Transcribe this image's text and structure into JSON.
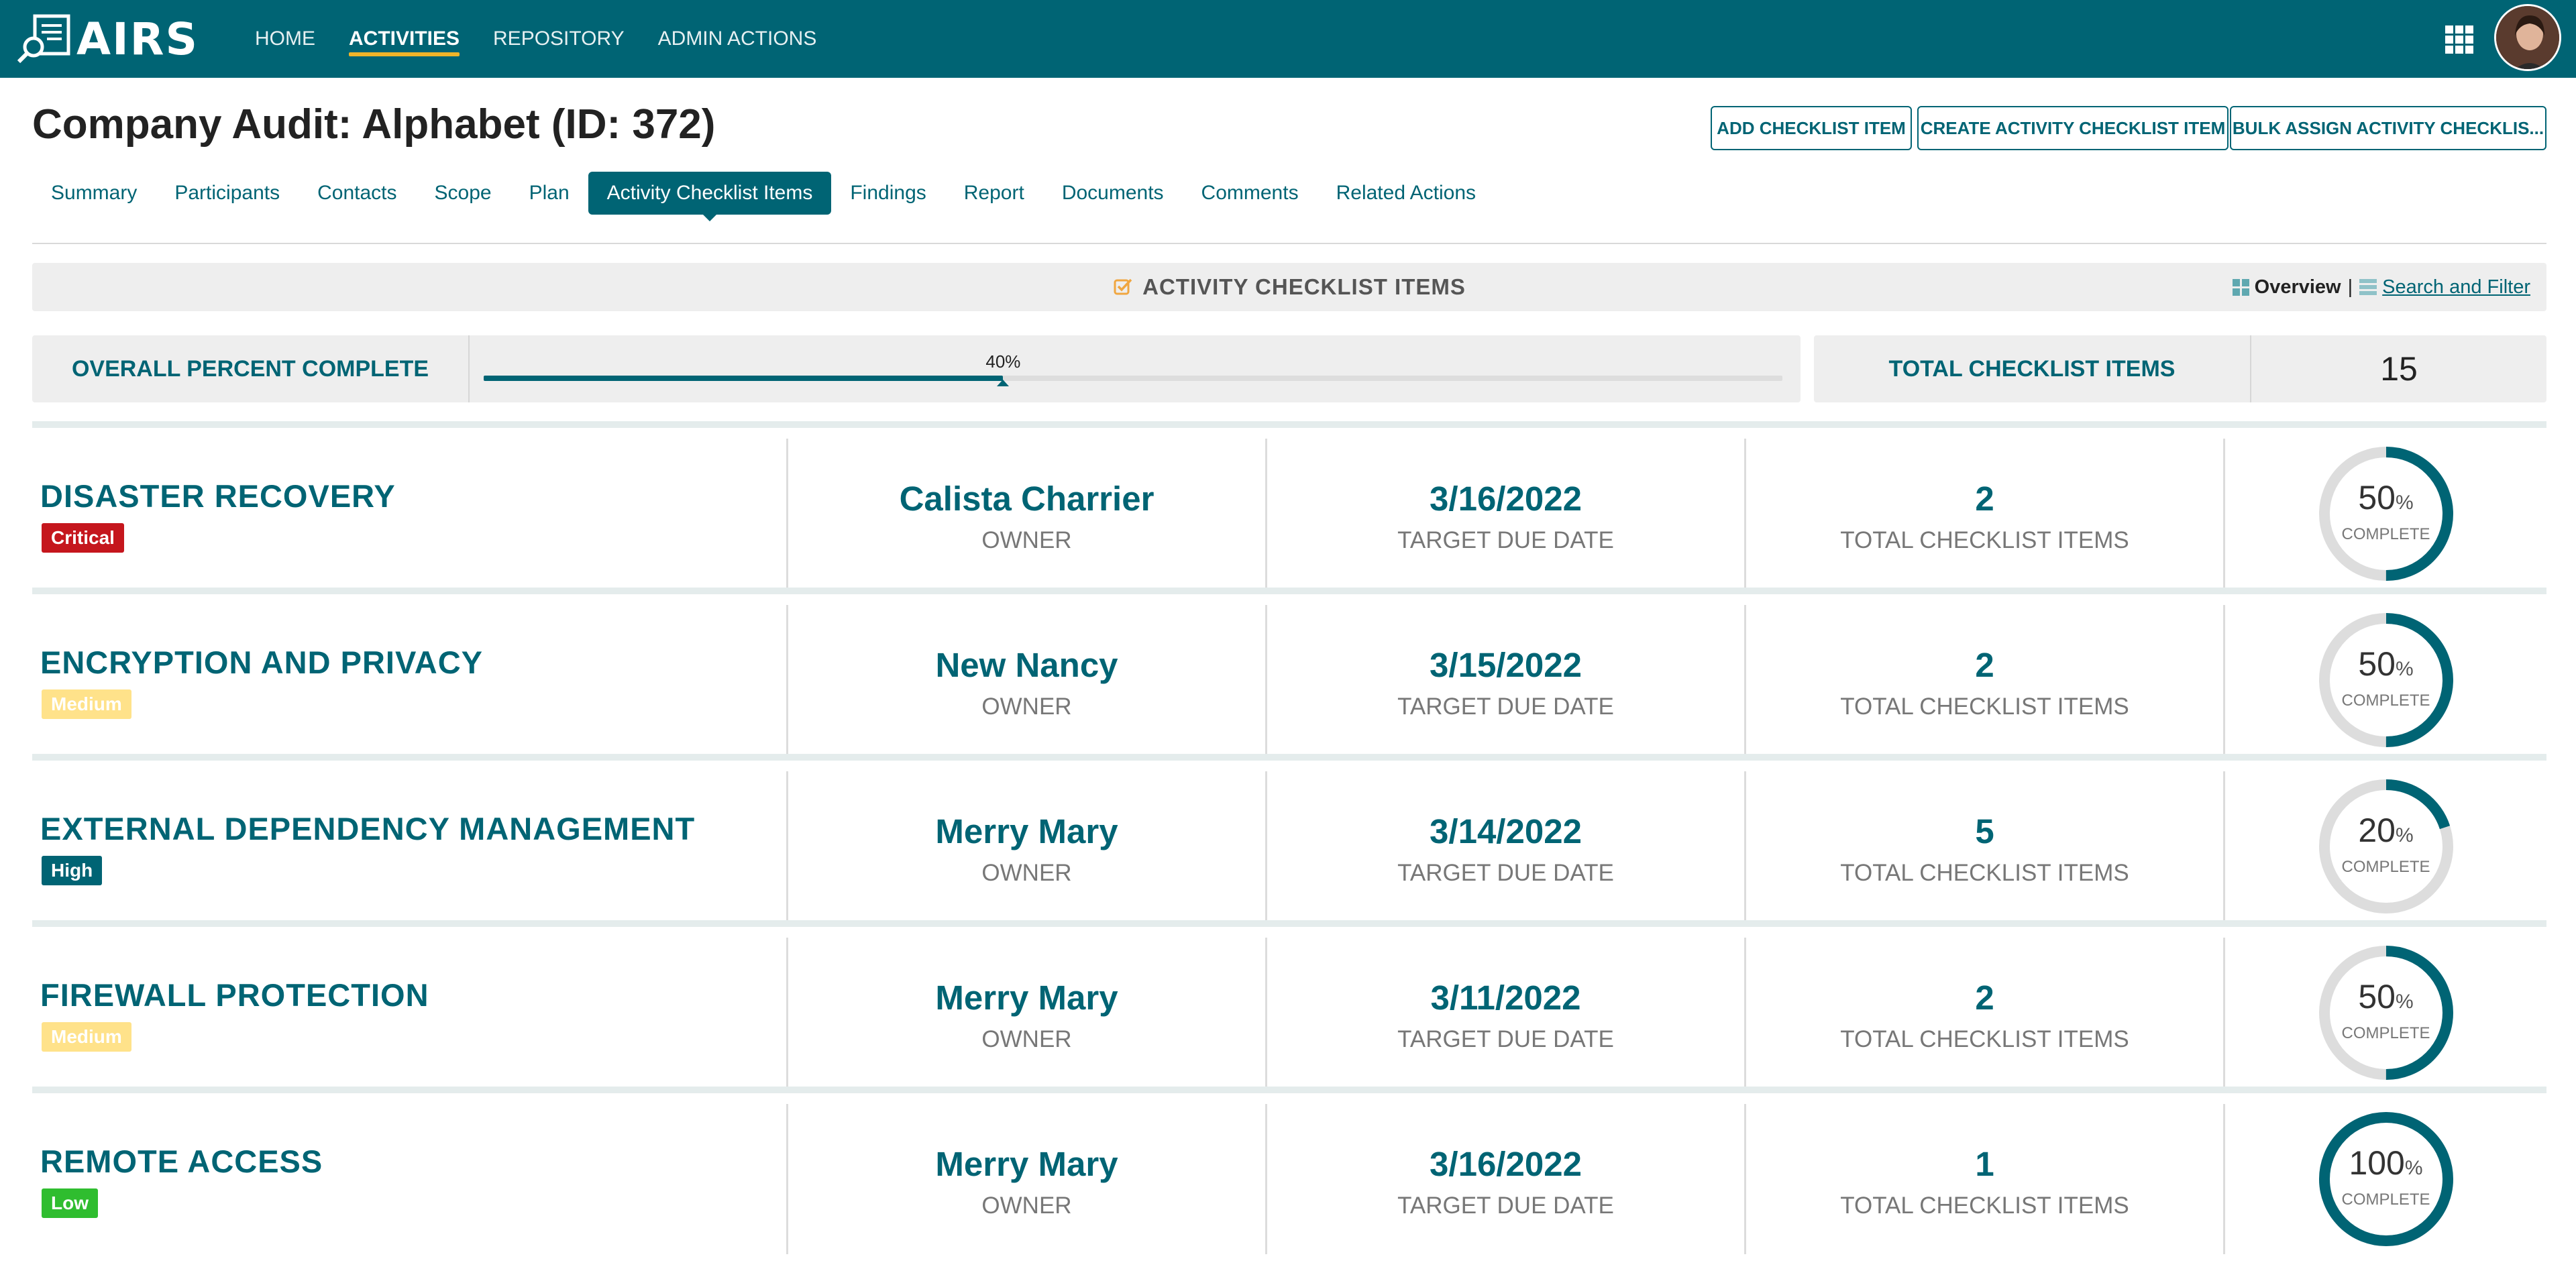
{
  "app": {
    "name": "AIRS"
  },
  "nav": {
    "items": [
      {
        "label": "HOME",
        "active": false
      },
      {
        "label": "ACTIVITIES",
        "active": true
      },
      {
        "label": "REPOSITORY",
        "active": false
      },
      {
        "label": "ADMIN ACTIONS",
        "active": false
      }
    ]
  },
  "header": {
    "title": "Company Audit: Alphabet (ID: 372)",
    "buttons": {
      "add": "ADD CHECKLIST ITEM",
      "create": "CREATE ACTIVITY CHECKLIST ITEM",
      "bulk": "BULK ASSIGN ACTIVITY CHECKLIS..."
    }
  },
  "tabs": [
    {
      "label": "Summary",
      "active": false
    },
    {
      "label": "Participants",
      "active": false
    },
    {
      "label": "Contacts",
      "active": false
    },
    {
      "label": "Scope",
      "active": false
    },
    {
      "label": "Plan",
      "active": false
    },
    {
      "label": "Activity Checklist Items",
      "active": true
    },
    {
      "label": "Findings",
      "active": false
    },
    {
      "label": "Report",
      "active": false
    },
    {
      "label": "Documents",
      "active": false
    },
    {
      "label": "Comments",
      "active": false
    },
    {
      "label": "Related Actions",
      "active": false
    }
  ],
  "section": {
    "title": "ACTIVITY CHECKLIST ITEMS",
    "view_overview": "Overview",
    "view_separator": "|",
    "view_search": "Search and Filter"
  },
  "summary": {
    "overall_label": "OVERALL PERCENT COMPLETE",
    "overall_percent_text": "40%",
    "overall_percent": 40,
    "total_label": "TOTAL CHECKLIST ITEMS",
    "total_value": "15"
  },
  "labels": {
    "owner": "OWNER",
    "due": "TARGET DUE DATE",
    "total": "TOTAL CHECKLIST ITEMS",
    "pct_sign": "%",
    "complete": "COMPLETE"
  },
  "items": [
    {
      "title": "DISASTER RECOVERY",
      "priority": "Critical",
      "priority_class": "critical",
      "owner": "Calista Charrier",
      "due": "3/16/2022",
      "total": "2",
      "percent": "50"
    },
    {
      "title": "ENCRYPTION AND PRIVACY",
      "priority": "Medium",
      "priority_class": "medium",
      "owner": "New Nancy",
      "due": "3/15/2022",
      "total": "2",
      "percent": "50"
    },
    {
      "title": "EXTERNAL DEPENDENCY MANAGEMENT",
      "priority": "High",
      "priority_class": "high",
      "owner": "Merry Mary",
      "due": "3/14/2022",
      "total": "5",
      "percent": "20"
    },
    {
      "title": "FIREWALL PROTECTION",
      "priority": "Medium",
      "priority_class": "medium",
      "owner": "Merry Mary",
      "due": "3/11/2022",
      "total": "2",
      "percent": "50"
    },
    {
      "title": "REMOTE ACCESS",
      "priority": "Low",
      "priority_class": "low",
      "owner": "Merry Mary",
      "due": "3/16/2022",
      "total": "1",
      "percent": "100"
    }
  ],
  "colors": {
    "brand": "#006474",
    "nav_active_underline": "#f0b429",
    "critical": "#c5161d",
    "medium": "#ffe28a",
    "high": "#006474",
    "low": "#2fbd2f",
    "ring_track": "#dddddd"
  },
  "icons": {
    "logo": "magnifier-document-icon",
    "apps": "apps-grid-icon",
    "section": "checkbox-icon",
    "overview": "grid-view-icon",
    "search": "list-view-icon"
  }
}
